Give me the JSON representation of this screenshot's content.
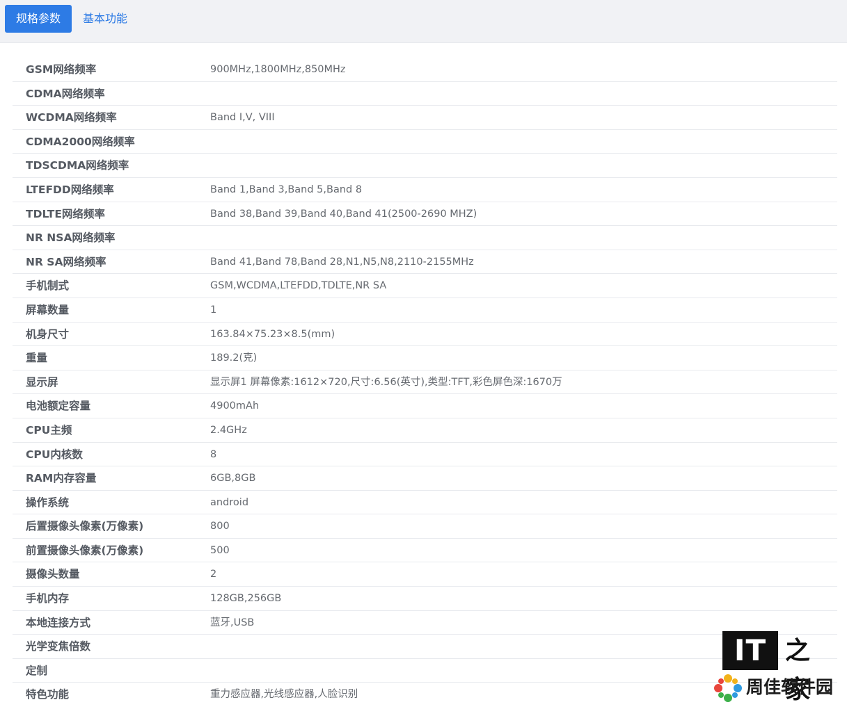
{
  "tabs": [
    {
      "label": "规格参数",
      "active": true
    },
    {
      "label": "基本功能",
      "active": false
    }
  ],
  "specs": [
    {
      "label": "GSM网络频率",
      "value": "900MHz,1800MHz,850MHz"
    },
    {
      "label": "CDMA网络频率",
      "value": ""
    },
    {
      "label": "WCDMA网络频率",
      "value": "Band Ⅰ,V, VIII"
    },
    {
      "label": "CDMA2000网络频率",
      "value": ""
    },
    {
      "label": "TDSCDMA网络频率",
      "value": ""
    },
    {
      "label": "LTEFDD网络频率",
      "value": "Band 1,Band 3,Band 5,Band 8"
    },
    {
      "label": "TDLTE网络频率",
      "value": "Band 38,Band 39,Band 40,Band 41(2500-2690 MHZ)"
    },
    {
      "label": "NR NSA网络频率",
      "value": ""
    },
    {
      "label": "NR SA网络频率",
      "value": "Band 41,Band 78,Band 28,N1,N5,N8,2110-2155MHz"
    },
    {
      "label": "手机制式",
      "value": "GSM,WCDMA,LTEFDD,TDLTE,NR SA"
    },
    {
      "label": "屏幕数量",
      "value": "1"
    },
    {
      "label": "机身尺寸",
      "value": "163.84×75.23×8.5(mm)"
    },
    {
      "label": "重量",
      "value": "189.2(克)"
    },
    {
      "label": "显示屏",
      "value": "显示屏1 屏幕像素:1612×720,尺寸:6.56(英寸),类型:TFT,彩色屏色深:1670万"
    },
    {
      "label": "电池额定容量",
      "value": "4900mAh"
    },
    {
      "label": "CPU主频",
      "value": "2.4GHz"
    },
    {
      "label": "CPU内核数",
      "value": "8"
    },
    {
      "label": "RAM内存容量",
      "value": "6GB,8GB"
    },
    {
      "label": "操作系统",
      "value": "android"
    },
    {
      "label": "后置摄像头像素(万像素)",
      "value": "800"
    },
    {
      "label": "前置摄像头像素(万像素)",
      "value": "500"
    },
    {
      "label": "摄像头数量",
      "value": "2"
    },
    {
      "label": "手机内存",
      "value": "128GB,256GB"
    },
    {
      "label": "本地连接方式",
      "value": "蓝牙,USB"
    },
    {
      "label": "光学变焦倍数",
      "value": ""
    },
    {
      "label": "定制",
      "value": ""
    },
    {
      "label": "特色功能",
      "value": "重力感应器,光线感应器,人脸识别"
    }
  ],
  "watermarks": {
    "ithome": {
      "it": "IT",
      "home": "之家"
    },
    "zhoujia": {
      "text": "周佳软件园",
      "icon": "pinwheel-logo-icon"
    }
  },
  "colors": {
    "accent": "#2d7be5",
    "tabbar_bg": "#f1f2f5",
    "label_text": "#555a62",
    "value_text": "#666a70",
    "divider": "#e8eaee"
  }
}
